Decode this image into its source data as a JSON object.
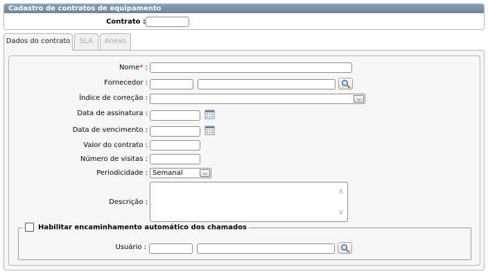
{
  "header": {
    "title": "Cadastro de contratos de equipamento",
    "contract_label": "Contrato :",
    "contract_value": ""
  },
  "tabs": [
    {
      "label": "Dados do contrato",
      "state": "active"
    },
    {
      "label": "SLA",
      "state": "disabled"
    },
    {
      "label": "Anexo",
      "state": "disabled"
    }
  ],
  "form": {
    "nome_label": "Nome",
    "nome_required": "*",
    "nome_colon": ":",
    "nome_value": "",
    "fornecedor_label": "Fornecedor :",
    "fornecedor_code": "",
    "fornecedor_name": "",
    "indice_label": "Índice de correção :",
    "indice_value": "",
    "data_assinatura_label": "Data de assinatura :",
    "data_assinatura_value": "",
    "data_vencimento_label": "Data de vencimento :",
    "data_vencimento_value": "",
    "valor_label": "Valor do contrato :",
    "valor_value": "",
    "visitas_label": "Número de visitas :",
    "visitas_value": "",
    "periodicidade_label": "Periodicidade :",
    "periodicidade_value": "Semanal",
    "descricao_label": "Descrição :",
    "descricao_value": ""
  },
  "encaminhamento": {
    "checkbox_label": "Habilitar encaminhamento automático dos chamados",
    "checked": false,
    "usuario_label": "Usuário :",
    "usuario_code": "",
    "usuario_name": ""
  },
  "icons": {
    "search": "magnifier-icon",
    "calendar": "calendar-icon",
    "dropdown": "chevron-down-icon"
  }
}
